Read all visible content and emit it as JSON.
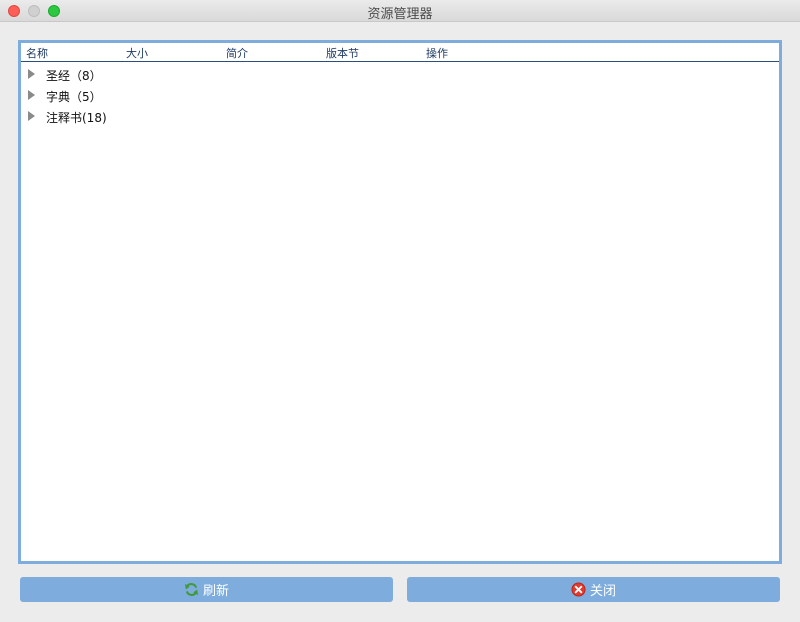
{
  "window": {
    "title": "资源管理器"
  },
  "tree": {
    "columns": [
      "名称",
      "大小",
      "简介",
      "版本节",
      "操作"
    ],
    "rows": [
      {
        "label": "圣经（8）"
      },
      {
        "label": "字典（5）"
      },
      {
        "label": "注释书(18)"
      }
    ]
  },
  "buttons": {
    "refresh": {
      "label": "刷新",
      "icon": "refresh-icon"
    },
    "close": {
      "label": "关闭",
      "icon": "close-circle-icon"
    }
  },
  "colors": {
    "accent": "#7eaddd",
    "header_text": "#1f3b66"
  }
}
